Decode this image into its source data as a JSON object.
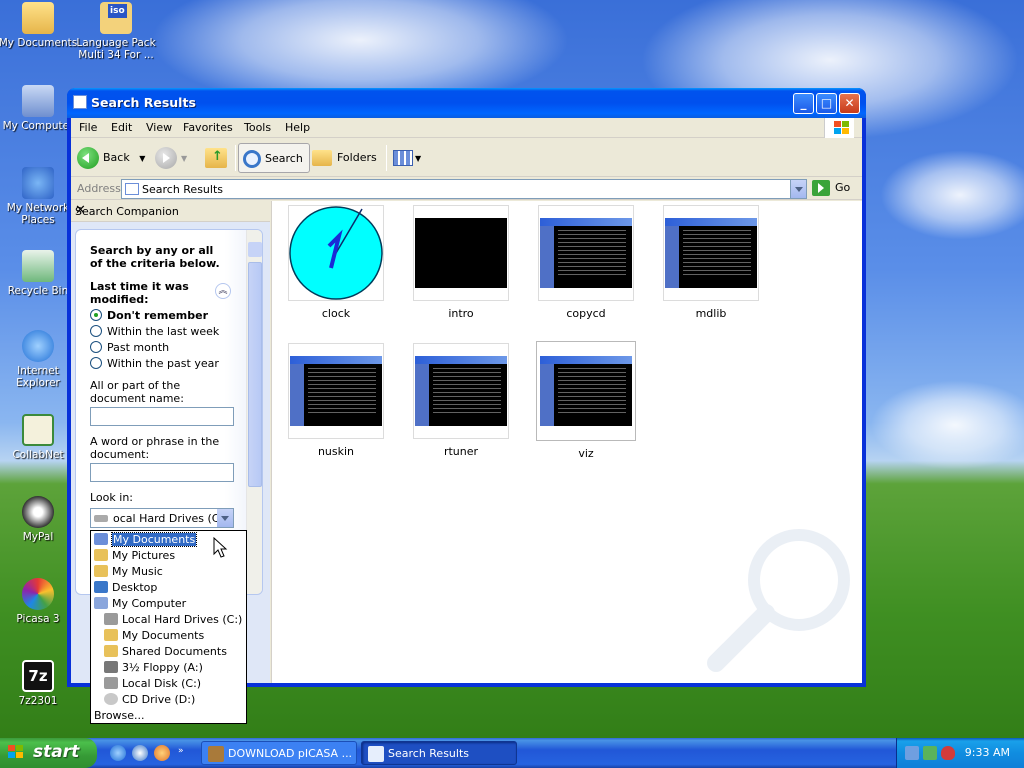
{
  "desktop": {
    "icons": [
      {
        "label": "My Documents"
      },
      {
        "label": "Language Pack Multi 34 For ..."
      },
      {
        "label": "My Computer"
      },
      {
        "label": "My Network Places"
      },
      {
        "label": "Recycle Bin"
      },
      {
        "label": "Internet Explorer"
      },
      {
        "label": "CollabNet"
      },
      {
        "label": "MyPal"
      },
      {
        "label": "Picasa 3"
      },
      {
        "label": "7z2301"
      }
    ],
    "iso_badge": "iso",
    "sevenzip_badge": "7z"
  },
  "window": {
    "title": "Search Results",
    "buttons": {
      "minimize": "_",
      "maximize": "□",
      "close": "✕"
    },
    "menu": [
      "File",
      "Edit",
      "View",
      "Favorites",
      "Tools",
      "Help"
    ],
    "toolbar": {
      "back": "Back",
      "search": "Search",
      "folders": "Folders"
    },
    "address": {
      "label": "Address",
      "value": "Search Results",
      "go": "Go"
    }
  },
  "search_companion": {
    "title": "Search Companion",
    "close": "✕",
    "intro": "Search by any or all of the criteria below.",
    "modified_heading": "Last time it was modified:",
    "collapse_glyph": "︽",
    "options": [
      {
        "label": "Don't remember",
        "selected": true
      },
      {
        "label": "Within the last week",
        "selected": false
      },
      {
        "label": "Past month",
        "selected": false
      },
      {
        "label": "Within the past year",
        "selected": false
      }
    ],
    "name_label": "All or part of the document name:",
    "name_value": "",
    "phrase_label": "A word or phrase in the document:",
    "phrase_value": "",
    "look_in_label": "Look in:",
    "look_in_value": "ocal Hard Drives (C:)"
  },
  "look_in_dropdown": [
    {
      "label": "My Documents",
      "indent": 0,
      "selected": true,
      "icon": "my-documents-icon"
    },
    {
      "label": "My Pictures",
      "indent": 0,
      "selected": false,
      "icon": "folder-icon"
    },
    {
      "label": "My Music",
      "indent": 0,
      "selected": false,
      "icon": "folder-icon"
    },
    {
      "label": "Desktop",
      "indent": 0,
      "selected": false,
      "icon": "desktop-icon"
    },
    {
      "label": "My Computer",
      "indent": 0,
      "selected": false,
      "icon": "computer-icon"
    },
    {
      "label": "Local Hard Drives (C:)",
      "indent": 1,
      "selected": false,
      "icon": "drive-icon"
    },
    {
      "label": "My Documents",
      "indent": 1,
      "selected": false,
      "icon": "folder-icon"
    },
    {
      "label": "Shared Documents",
      "indent": 1,
      "selected": false,
      "icon": "folder-icon"
    },
    {
      "label": "3½ Floppy (A:)",
      "indent": 1,
      "selected": false,
      "icon": "floppy-icon"
    },
    {
      "label": "Local Disk (C:)",
      "indent": 1,
      "selected": false,
      "icon": "drive-icon"
    },
    {
      "label": "CD Drive (D:)",
      "indent": 1,
      "selected": false,
      "icon": "cd-icon"
    },
    {
      "label": "Browse...",
      "indent": 0,
      "selected": false,
      "icon": ""
    }
  ],
  "results": [
    {
      "name": "clock",
      "kind": "clock"
    },
    {
      "name": "intro",
      "kind": "black"
    },
    {
      "name": "copycd",
      "kind": "screenshot"
    },
    {
      "name": "mdlib",
      "kind": "screenshot"
    },
    {
      "name": "nuskin",
      "kind": "screenshot"
    },
    {
      "name": "rtuner",
      "kind": "screenshot"
    },
    {
      "name": "viz",
      "kind": "screenshot"
    }
  ],
  "taskbar": {
    "start": "start",
    "tasks": [
      {
        "label": "DOWNLOAD pICASA ...",
        "active": false
      },
      {
        "label": "Search Results",
        "active": true
      }
    ],
    "clock": "9:33 AM"
  },
  "colors": {
    "titlebar": "#0053ee",
    "selection": "#316ac5",
    "clock_face": "#00ffff",
    "radio_dot": "#21a121"
  }
}
